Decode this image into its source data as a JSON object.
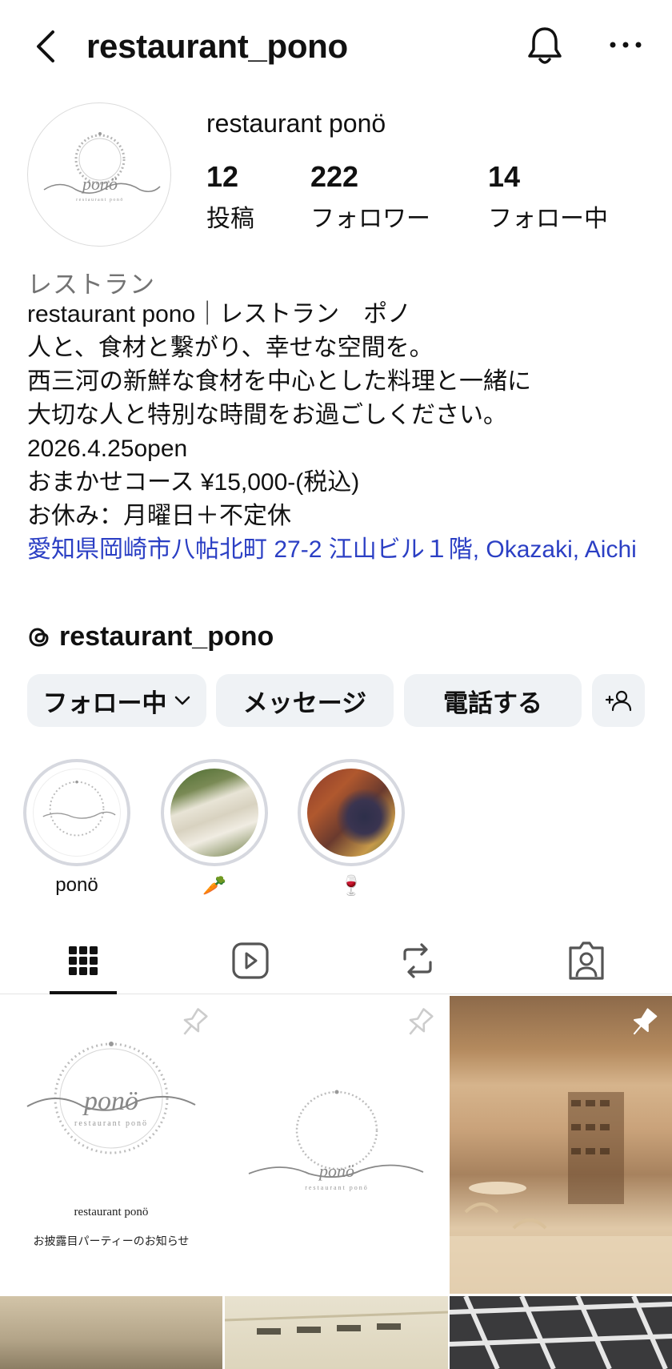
{
  "header": {
    "title": "restaurant_pono"
  },
  "profile": {
    "display_name": "restaurant ponö",
    "logo_text": "ponö",
    "logo_subtext": "restaurant ponö",
    "stats": [
      {
        "num": "12",
        "label": "投稿"
      },
      {
        "num": "222",
        "label": "フォロワー"
      },
      {
        "num": "14",
        "label": "フォロー中"
      }
    ],
    "category": "レストラン",
    "bio_lines": [
      "restaurant pono｜レストラン　ポノ",
      "人と、食材と繋がり、幸せな空間を。",
      "西三河の新鮮な食材を中心とした料理と一緒に",
      "大切な人と特別な時間をお過ごしください。",
      "2026.4.25open",
      "おまかせコース ¥15,000-(税込)",
      "お休み：月曜日＋不定休"
    ],
    "address": "愛知県岡崎市八帖北町 27-2 江山ビル１階, Okazaki, Aichi",
    "threads_handle": "restaurant_pono"
  },
  "actions": {
    "following": "フォロー中",
    "message": "メッセージ",
    "call": "電話する"
  },
  "highlights": [
    {
      "label": "ponö"
    },
    {
      "label": "🥕"
    },
    {
      "label": "🍷"
    }
  ],
  "posts": {
    "post1_title": "restaurant ponö",
    "post1_caption": "お披露目パーティーのお知らせ"
  },
  "colors": {
    "link": "#2b3fc4",
    "button_bg": "#eff2f5",
    "muted": "#737373"
  }
}
